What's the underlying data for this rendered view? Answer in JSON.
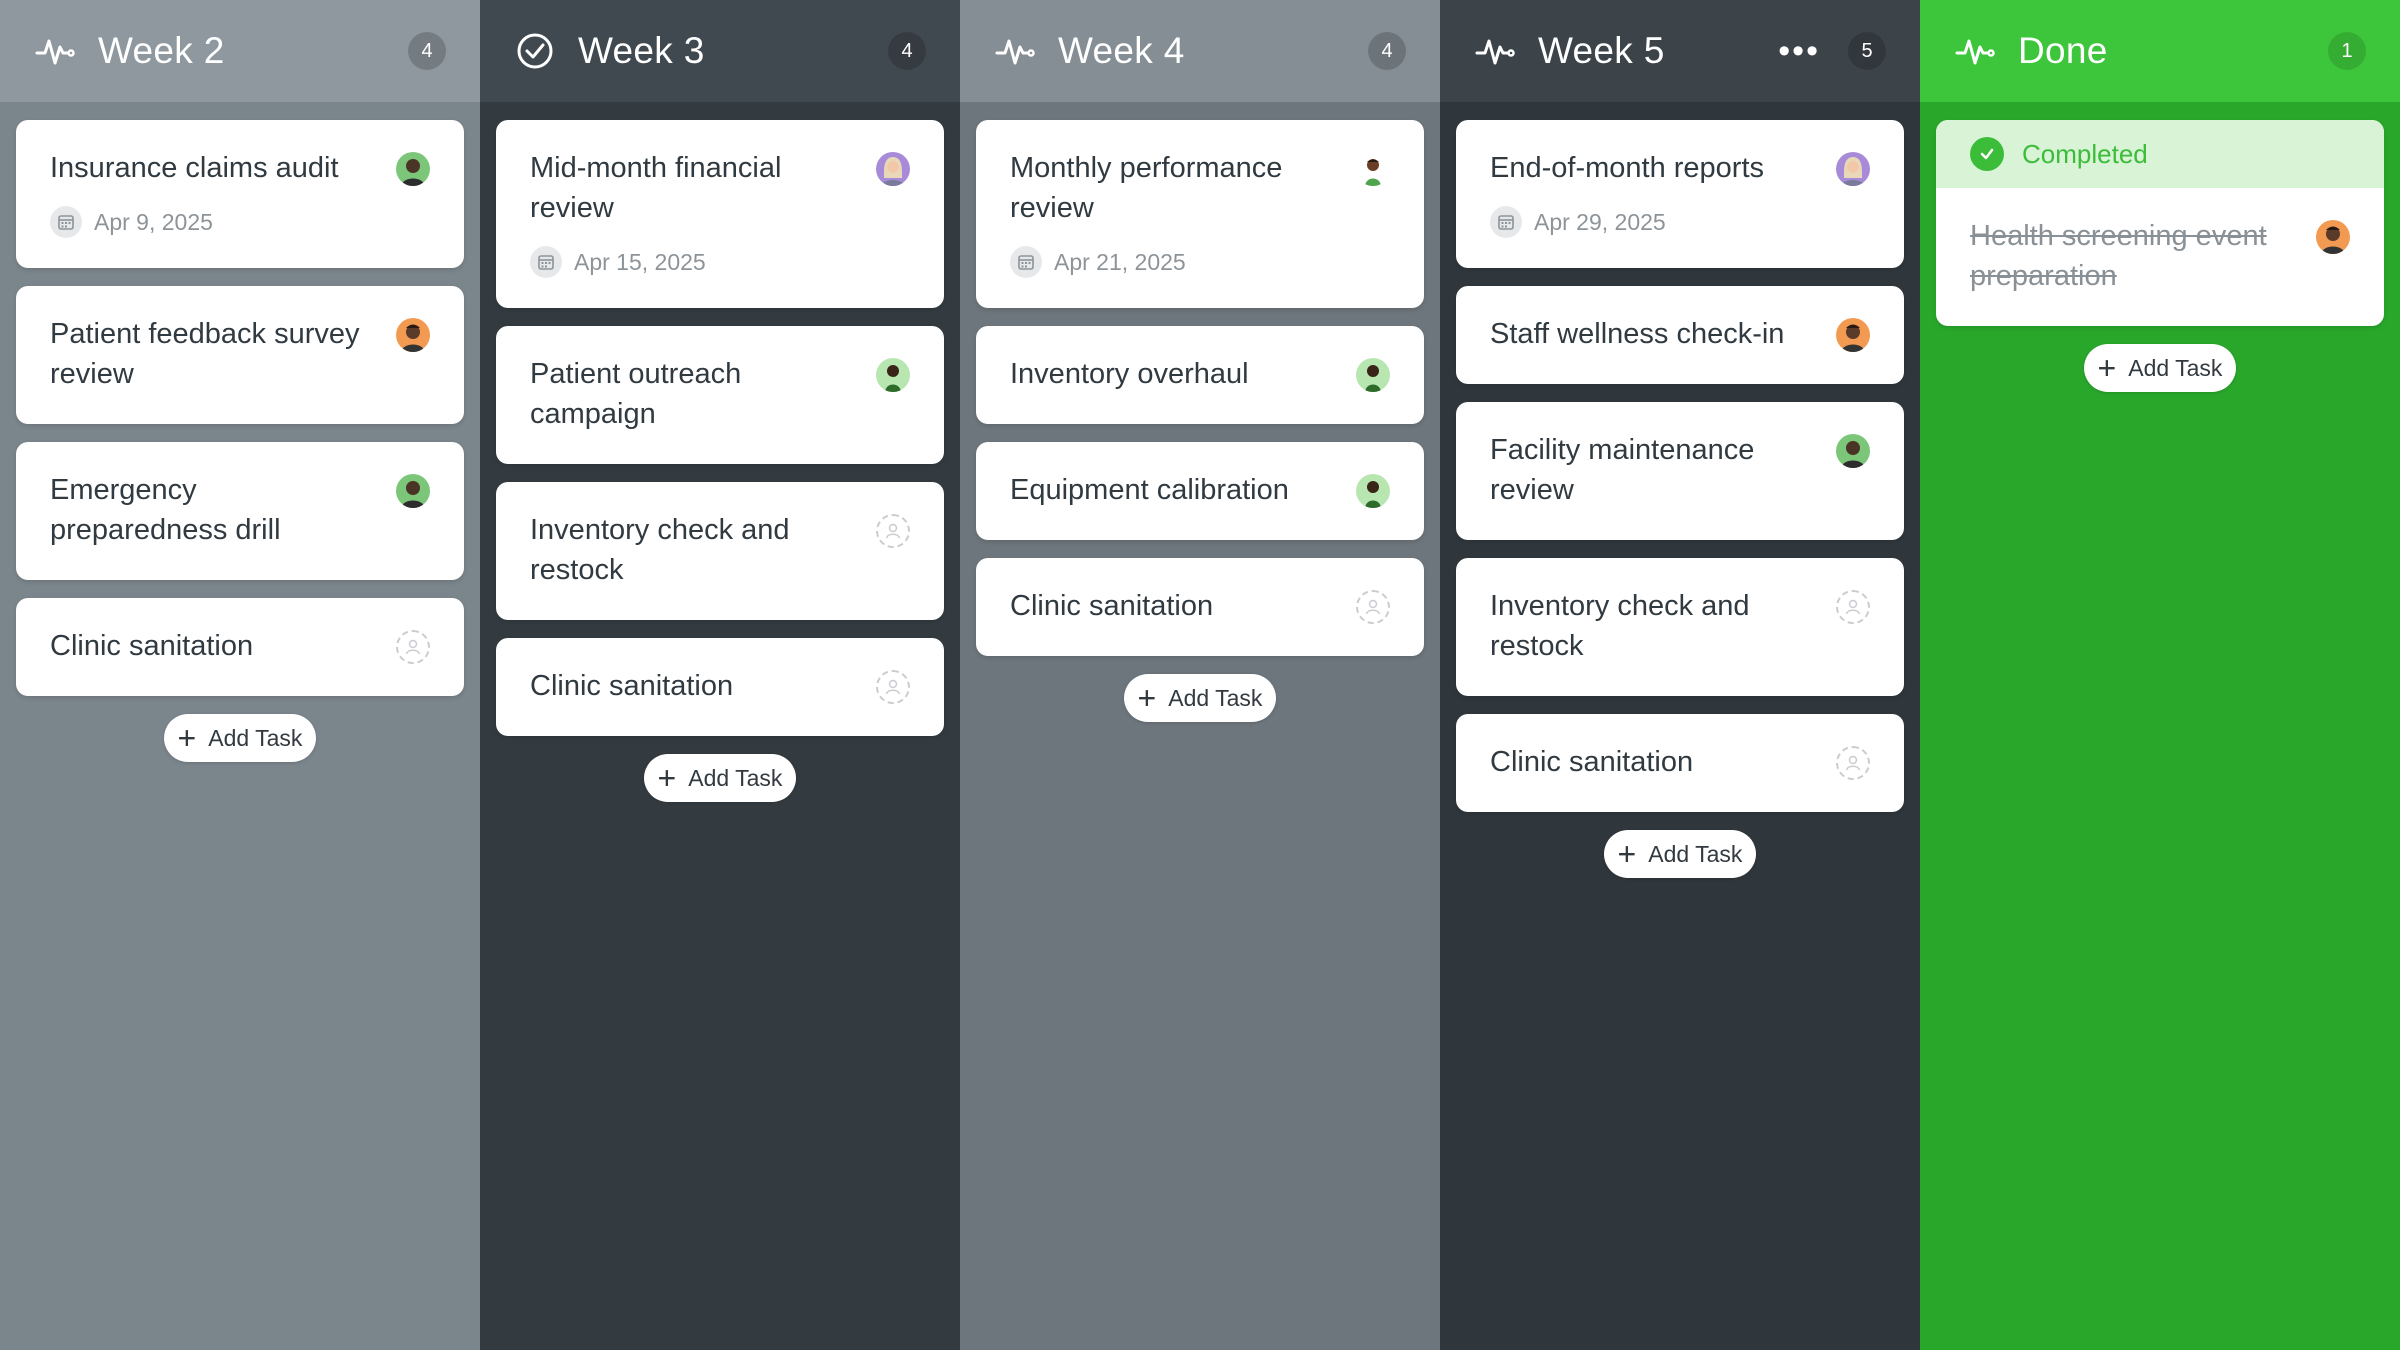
{
  "columns": [
    {
      "id": "week2",
      "title": "Week 2",
      "icon": "pulse-icon",
      "count": "4",
      "cards": [
        {
          "title": "Insurance claims audit",
          "due": "Apr 9, 2025",
          "assignee": "avatar-man-dark-green"
        },
        {
          "title": "Patient feedback survey review",
          "due": "",
          "assignee": "avatar-man-orange"
        },
        {
          "title": "Emergency preparedness drill",
          "due": "",
          "assignee": "avatar-man-dark-green"
        },
        {
          "title": "Clinic sanitation",
          "due": "",
          "assignee": "unassigned"
        }
      ],
      "add_label": "Add Task"
    },
    {
      "id": "week3",
      "title": "Week 3",
      "icon": "check-circle-icon",
      "count": "4",
      "cards": [
        {
          "title": "Mid-month financial review",
          "due": "Apr 15, 2025",
          "assignee": "avatar-woman-purple"
        },
        {
          "title": "Patient outreach campaign",
          "due": "",
          "assignee": "avatar-man-green-small"
        },
        {
          "title": "Inventory check and restock",
          "due": "",
          "assignee": "unassigned"
        },
        {
          "title": "Clinic sanitation",
          "due": "",
          "assignee": "unassigned"
        }
      ],
      "add_label": "Add Task"
    },
    {
      "id": "week4",
      "title": "Week 4",
      "icon": "pulse-icon",
      "count": "4",
      "cards": [
        {
          "title": "Monthly performance review",
          "due": "Apr 21, 2025",
          "assignee": "avatar-man-green-small"
        },
        {
          "title": "Inventory overhaul",
          "due": "",
          "assignee": "avatar-man-green-small"
        },
        {
          "title": "Equipment calibration",
          "due": "",
          "assignee": "avatar-man-green-small"
        },
        {
          "title": "Clinic sanitation",
          "due": "",
          "assignee": "unassigned"
        }
      ],
      "add_label": "Add Task"
    },
    {
      "id": "week5",
      "title": "Week 5",
      "icon": "pulse-icon",
      "more": "•••",
      "count": "5",
      "cards": [
        {
          "title": "End-of-month reports",
          "due": "Apr 29, 2025",
          "assignee": "avatar-woman-purple"
        },
        {
          "title": "Staff wellness check-in",
          "due": "",
          "assignee": "avatar-man-orange"
        },
        {
          "title": "Facility maintenance review",
          "due": "",
          "assignee": "avatar-man-dark-green"
        },
        {
          "title": "Inventory check and restock",
          "due": "",
          "assignee": "unassigned"
        },
        {
          "title": "Clinic sanitation",
          "due": "",
          "assignee": "unassigned"
        }
      ],
      "add_label": "Add Task"
    },
    {
      "id": "done",
      "title": "Done",
      "icon": "pulse-icon",
      "count": "1",
      "status_label": "Completed",
      "cards": [
        {
          "title": "Health screening event preparation",
          "due": "",
          "assignee": "avatar-man-orange"
        }
      ],
      "add_label": "Add Task"
    }
  ],
  "colors": {
    "done_green": "#29a72b",
    "completed_text": "#3bbd3a",
    "card_text": "#303a40"
  }
}
